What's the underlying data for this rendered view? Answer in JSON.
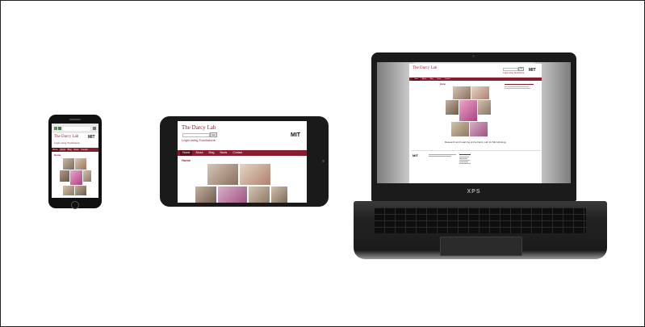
{
  "site": {
    "title": "The Darcy Lab",
    "login": "Login using Touchstone",
    "go_button": "Go",
    "mit_logo": "MIT",
    "nav": [
      "Home",
      "About",
      "Blog",
      "News",
      "Contact"
    ],
    "page_heading": "Home",
    "tagline": "Research and Learning at the Darcy Lab for Microbiology"
  },
  "laptop": {
    "brand": "XPS"
  },
  "colors": {
    "brand": "#8a1c2f",
    "device_black": "#1a1a1a"
  },
  "icons": [
    "phone-home-button-icon",
    "camera-icon",
    "speaker-icon"
  ]
}
